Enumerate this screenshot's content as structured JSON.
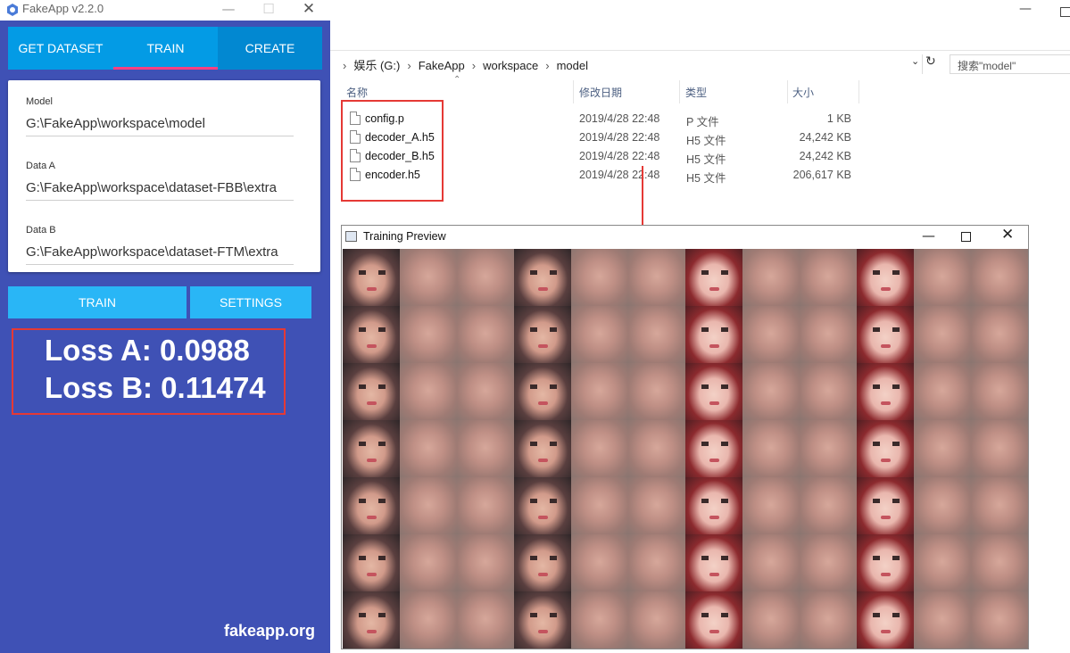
{
  "fakeapp": {
    "title": "FakeApp v2.2.0",
    "tabs": [
      "GET DATASET",
      "TRAIN",
      "CREATE"
    ],
    "fields": [
      {
        "label": "Model",
        "value": "G:\\FakeApp\\workspace\\model"
      },
      {
        "label": "Data A",
        "value": "G:\\FakeApp\\workspace\\dataset-FBB\\extra"
      },
      {
        "label": "Data B",
        "value": "G:\\FakeApp\\workspace\\dataset-FTM\\extra"
      }
    ],
    "buttons": {
      "train": "TRAIN",
      "settings": "SETTINGS"
    },
    "loss": {
      "a": "Loss A: 0.0988",
      "b": "Loss B: 0.11474"
    },
    "footer": "fakeapp.org",
    "accent": "#3f51b5",
    "tab_color": "#039be5",
    "button_color": "#29b6f6"
  },
  "explorer": {
    "path": [
      "娱乐 (G:)",
      "FakeApp",
      "workspace",
      "model"
    ],
    "search_placeholder": "搜索\"model\"",
    "columns": [
      "名称",
      "修改日期",
      "类型",
      "大小"
    ],
    "files": [
      {
        "name": "config.p",
        "date": "2019/4/28 22:48",
        "type": "P 文件",
        "size": "1 KB"
      },
      {
        "name": "decoder_A.h5",
        "date": "2019/4/28 22:48",
        "type": "H5 文件",
        "size": "24,242 KB"
      },
      {
        "name": "decoder_B.h5",
        "date": "2019/4/28 22:48",
        "type": "H5 文件",
        "size": "24,242 KB"
      },
      {
        "name": "encoder.h5",
        "date": "2019/4/28 22:48",
        "type": "H5 文件",
        "size": "206,617 KB"
      }
    ]
  },
  "preview": {
    "title": "Training Preview"
  }
}
